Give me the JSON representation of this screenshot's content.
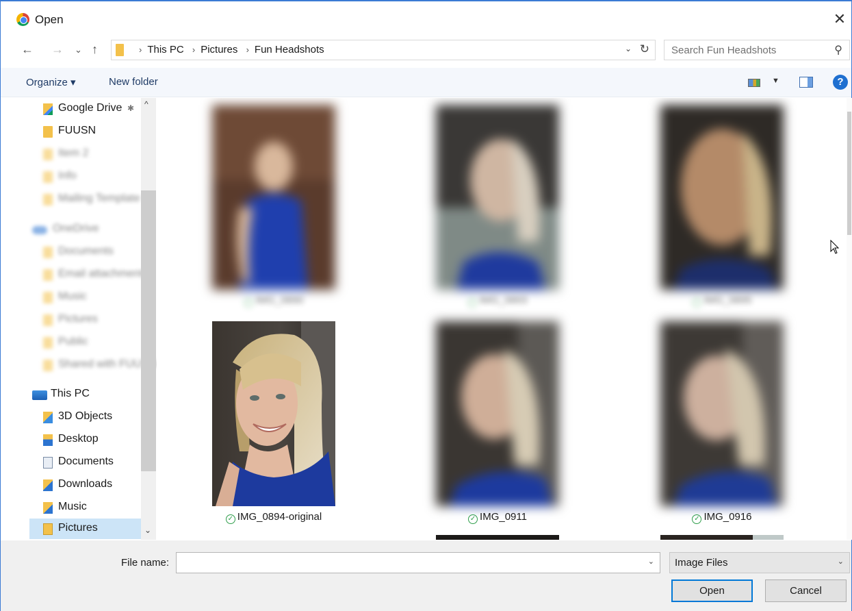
{
  "window": {
    "title": "Open",
    "close_glyph": "✕"
  },
  "nav": {
    "back_glyph": "←",
    "forward_glyph": "→",
    "recent_glyph": "⌄",
    "up_glyph": "↑",
    "breadcrumbs": [
      "This PC",
      "Pictures",
      "Fun Headshots"
    ],
    "refresh_glyph": "↻",
    "search_placeholder": "Search Fun Headshots"
  },
  "toolbar": {
    "organize": "Organize ▾",
    "new_folder": "New folder",
    "help": "?"
  },
  "sidebar": {
    "items": [
      {
        "label": "Google Drive",
        "icon": "google-drive-icon",
        "pinned": true
      },
      {
        "label": "FUUSN",
        "icon": "folder-icon"
      },
      {
        "label": "Item 2",
        "icon": "folder-icon",
        "obscured": true
      },
      {
        "label": "Info",
        "icon": "folder-icon",
        "obscured": true
      },
      {
        "label": "Mailing Template",
        "icon": "folder-icon",
        "obscured": true
      },
      {
        "label": "OneDrive",
        "icon": "onedrive-icon",
        "obscured": true
      },
      {
        "label": "Documents",
        "icon": "folder-icon",
        "obscured": true
      },
      {
        "label": "Email attachments",
        "icon": "folder-icon",
        "obscured": true
      },
      {
        "label": "Music",
        "icon": "folder-icon",
        "obscured": true
      },
      {
        "label": "Pictures",
        "icon": "folder-icon",
        "obscured": true
      },
      {
        "label": "Public",
        "icon": "folder-icon",
        "obscured": true
      },
      {
        "label": "Shared with FUUSN",
        "icon": "folder-icon",
        "obscured": true
      },
      {
        "label": "This PC",
        "icon": "this-pc-icon"
      },
      {
        "label": "3D Objects",
        "icon": "3d-objects-icon"
      },
      {
        "label": "Desktop",
        "icon": "desktop-icon"
      },
      {
        "label": "Documents",
        "icon": "documents-icon"
      },
      {
        "label": "Downloads",
        "icon": "downloads-icon"
      },
      {
        "label": "Music",
        "icon": "music-icon"
      },
      {
        "label": "Pictures",
        "icon": "pictures-icon",
        "selected": true
      }
    ]
  },
  "files": [
    {
      "name": "IMG_0890",
      "obscured": true
    },
    {
      "name": "IMG_0893",
      "obscured": true
    },
    {
      "name": "IMG_0895",
      "obscured": true
    },
    {
      "name": "IMG_0894-original",
      "obscured": false
    },
    {
      "name": "IMG_0911",
      "obscured": true
    },
    {
      "name": "IMG_0916",
      "obscured": true
    }
  ],
  "bottom": {
    "file_name_label": "File name:",
    "file_name_value": "",
    "file_type": "Image Files",
    "open_label": "Open",
    "cancel_label": "Cancel"
  }
}
